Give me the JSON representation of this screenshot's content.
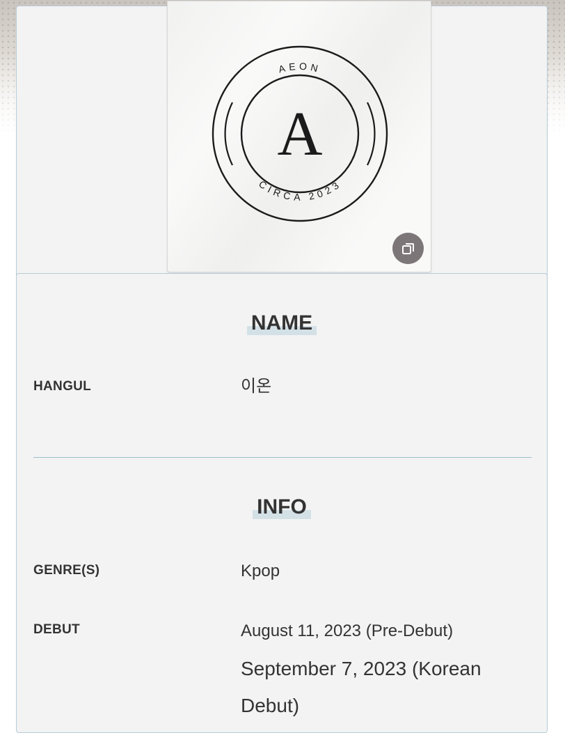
{
  "image": {
    "logo": {
      "top_text": "AEON",
      "letter": "A",
      "bottom_text": "CIRCA 2023"
    },
    "gallery_button_icon": "gallery-stack-icon"
  },
  "name_section": {
    "title": "NAME",
    "rows": [
      {
        "label": "HANGUL",
        "value": "이온"
      }
    ]
  },
  "info_section": {
    "title": "INFO",
    "genre": {
      "label": "GENRE(S)",
      "value": "Kpop"
    },
    "debut": {
      "label": "DEBUT",
      "line1": "August 11, 2023 (Pre-Debut)",
      "line2": "September 7, 2023 (Korean Debut)"
    }
  },
  "colors": {
    "card_bg": "#f3f3f3",
    "card_border": "#b6cbd6",
    "title_highlight": "#d3e1e7",
    "text": "#333333",
    "gallery_button": "#7d7678"
  }
}
